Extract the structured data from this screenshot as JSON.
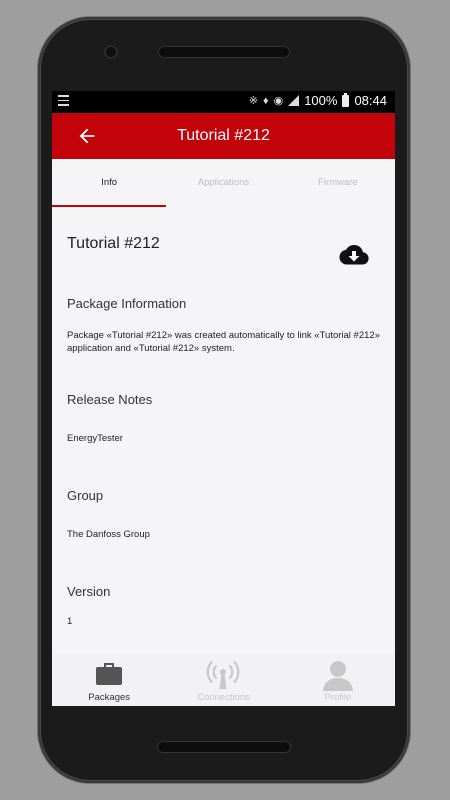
{
  "status_bar": {
    "battery": "100%",
    "time": "08:44"
  },
  "toolbar": {
    "title": "Tutorial #212"
  },
  "tabs": [
    {
      "label": "Info",
      "active": true
    },
    {
      "label": "Applications",
      "active": false
    },
    {
      "label": "Firmware",
      "active": false
    }
  ],
  "package": {
    "title": "Tutorial #212",
    "info_heading": "Package Information",
    "info_text": "Package «Tutorial #212» was created automatically to link «Tutorial #212» application and «Tutorial #212» system.",
    "release_heading": "Release Notes",
    "release_text": "EnergyTester",
    "group_heading": "Group",
    "group_text": "The Danfoss Group",
    "version_heading": "Version",
    "version_text": "1"
  },
  "bottom_nav": [
    {
      "label": "Packages",
      "icon": "briefcase-icon",
      "active": true
    },
    {
      "label": "Connections",
      "icon": "antenna-icon",
      "active": false
    },
    {
      "label": "Profile",
      "icon": "user-icon",
      "active": false
    }
  ],
  "colors": {
    "accent": "#c2040a",
    "background": "#f5f5f8"
  }
}
